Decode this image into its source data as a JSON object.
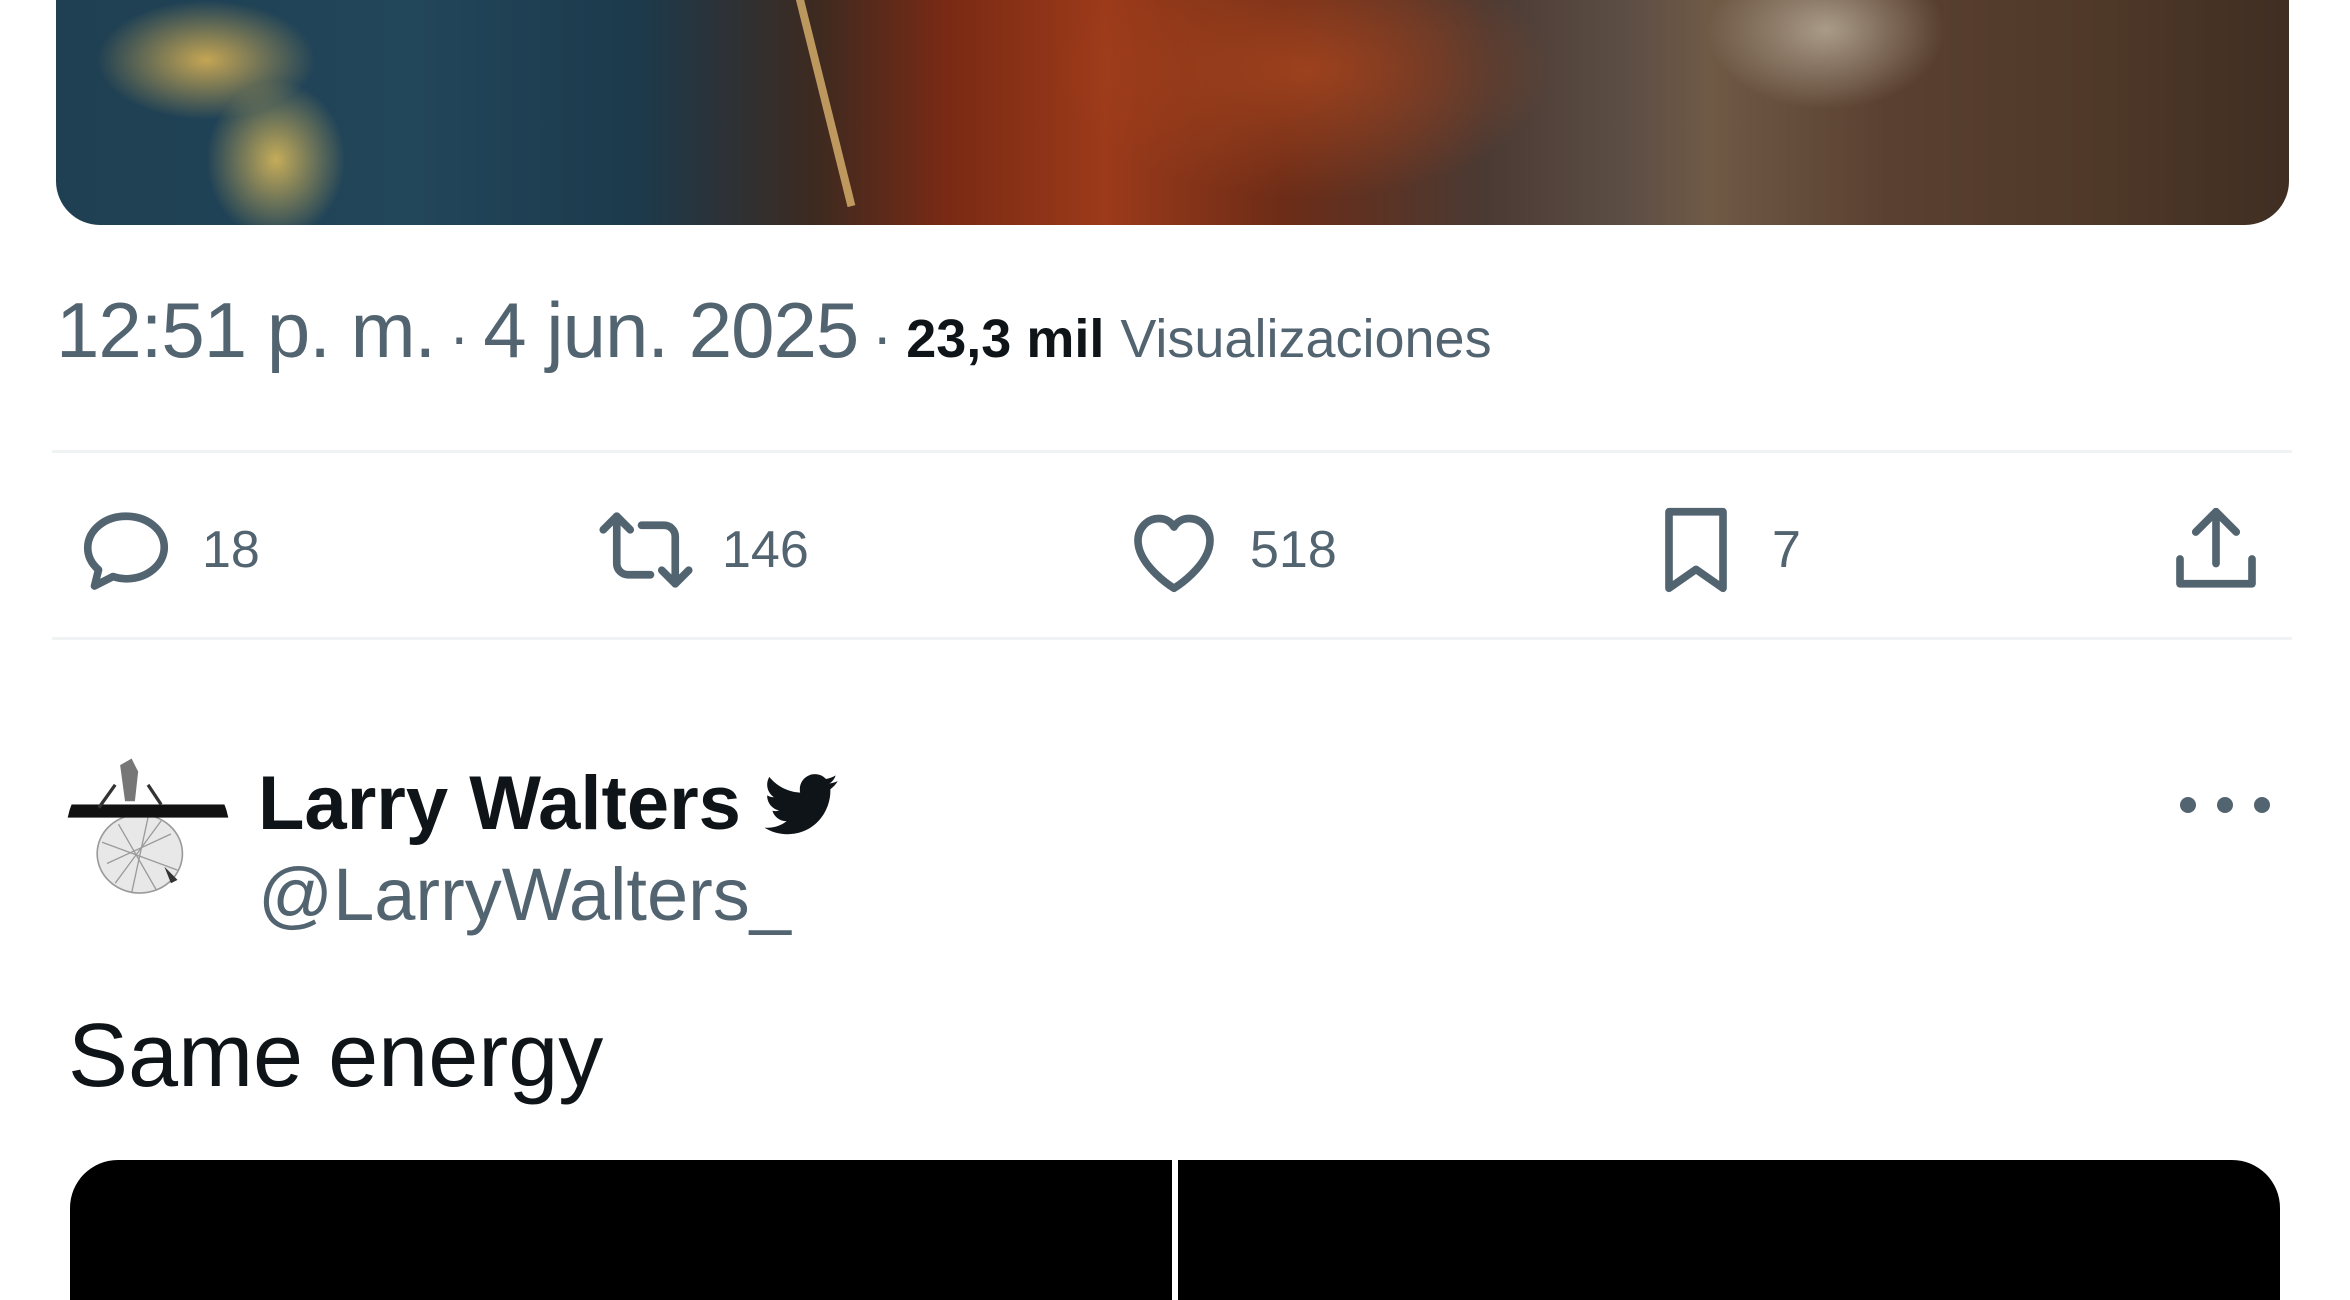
{
  "tweet": {
    "time": "12:51 p. m.",
    "separator": "·",
    "date": "4 jun. 2025",
    "views_count": "23,3 mil",
    "views_label": "Visualizaciones"
  },
  "actions": {
    "replies": "18",
    "retweets": "146",
    "likes": "518",
    "bookmarks": "7"
  },
  "reply": {
    "name": "Larry Walters",
    "handle": "@LarryWalters_",
    "text": "Same energy"
  },
  "icons": {
    "reply": "reply-icon",
    "retweet": "retweet-icon",
    "like": "heart-icon",
    "bookmark": "bookmark-icon",
    "share": "share-icon",
    "badge": "bird-icon",
    "more": "more-icon"
  },
  "colors": {
    "text_primary": "#0f1419",
    "text_secondary": "#536471",
    "divider": "#eff3f4"
  }
}
